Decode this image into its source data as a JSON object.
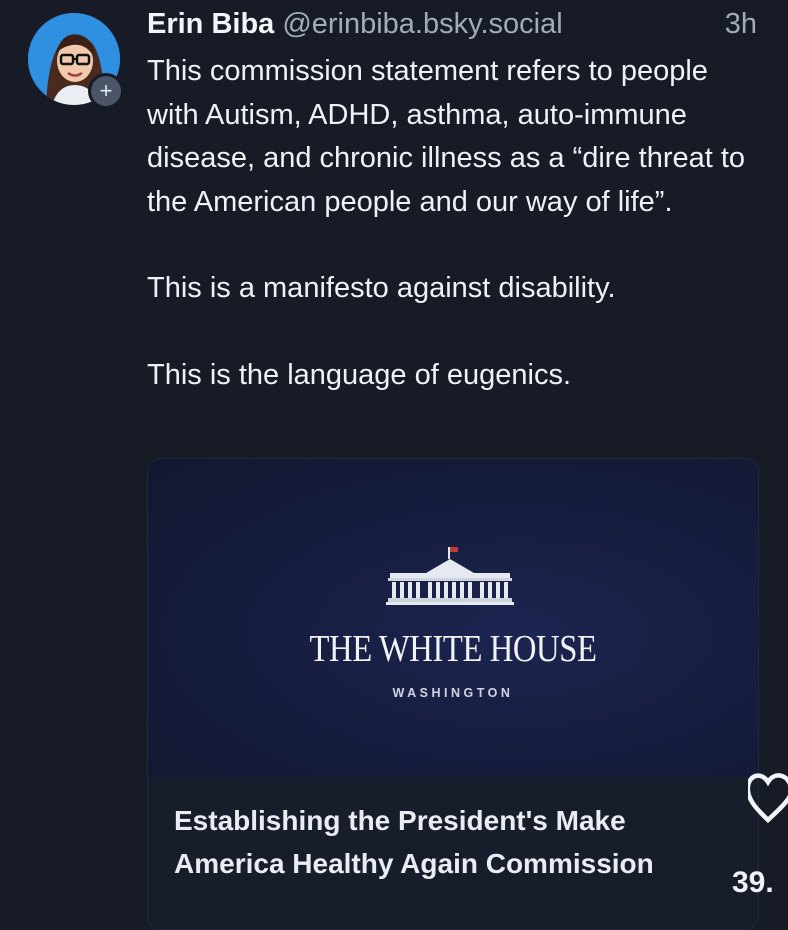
{
  "post": {
    "author_name": "Erin Biba",
    "author_handle": "@erinbiba.bsky.social",
    "timestamp": "3h",
    "avatar_icon": "cartoon-avatar-icon",
    "follow_icon": "plus-icon",
    "follow_glyph": "+",
    "body": [
      "This commission statement refers to people with Autism, ADHD, asthma, auto-immune disease, and chronic illness as a “dire threat to the American people and our way of life”.",
      "This is a manifesto against disability.",
      "This is the language of eugenics."
    ]
  },
  "link_card": {
    "image_title": "THE WHITE HOUSE",
    "image_subtitle": "WASHINGTON",
    "title": "Establishing the President's Make America Healthy Again Commission"
  },
  "actions": {
    "like_icon": "heart-icon",
    "like_count": "39."
  }
}
